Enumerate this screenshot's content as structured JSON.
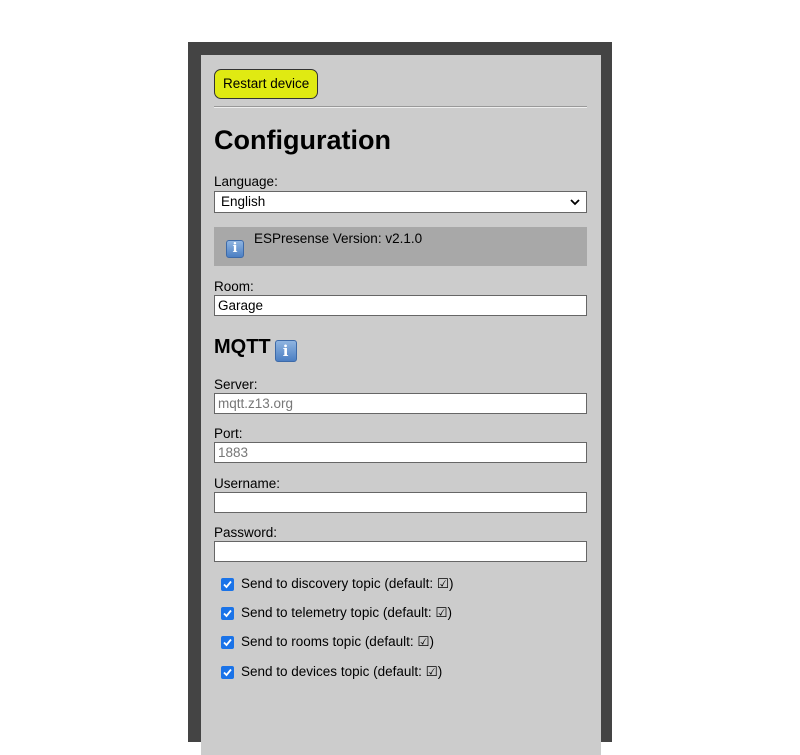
{
  "toolbar": {
    "restart_label": "Restart device"
  },
  "heading": "Configuration",
  "language": {
    "label": "Language:",
    "selected": "English"
  },
  "version_info": {
    "text": "ESPresense Version: v2.1.0",
    "icon": "info-icon"
  },
  "room": {
    "label": "Room:",
    "value": "Garage"
  },
  "mqtt": {
    "heading": "MQTT",
    "server": {
      "label": "Server:",
      "placeholder": "mqtt.z13.org"
    },
    "port": {
      "label": "Port:",
      "placeholder": "1883"
    },
    "username": {
      "label": "Username:",
      "value": ""
    },
    "password": {
      "label": "Password:",
      "value": ""
    },
    "checkboxes": [
      {
        "label": "Send to discovery topic (default: ☑)",
        "checked": true
      },
      {
        "label": "Send to telemetry topic (default: ☑)",
        "checked": true
      },
      {
        "label": "Send to rooms topic (default: ☑)",
        "checked": true
      },
      {
        "label": "Send to devices topic (default: ☑)",
        "checked": true
      }
    ]
  },
  "colors": {
    "restart_button": "#e0ea12",
    "panel": "#cccccc",
    "frame": "#444444",
    "info_box": "#a8a8a8",
    "checkbox": "#1a73e8"
  }
}
